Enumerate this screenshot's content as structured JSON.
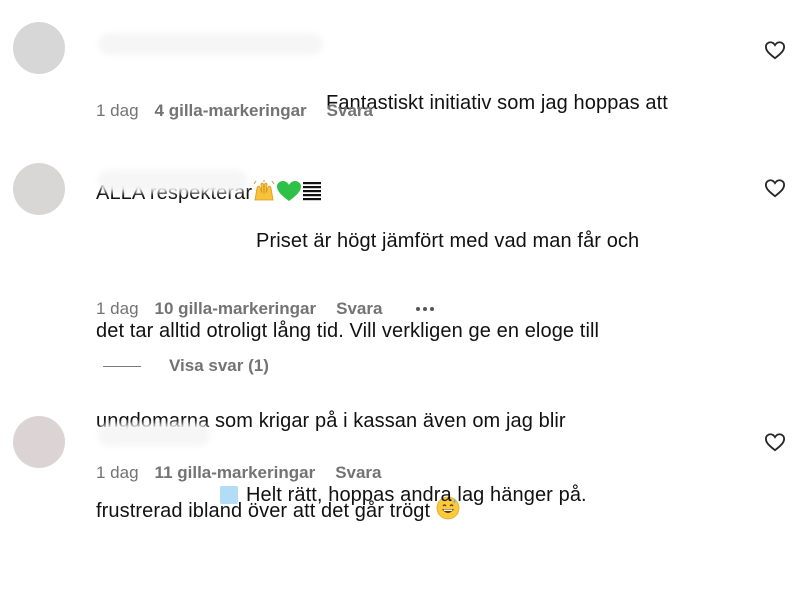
{
  "comments": [
    {
      "text_line1": "Fantastiskt initiativ som jag hoppas att",
      "text_line2": "ALLA respekterar",
      "emojis": [
        "raising-hands",
        "green-heart",
        "barcode"
      ],
      "time": "1 dag",
      "likes": "4 gilla-markeringar",
      "reply": "Svara",
      "avatar_color": "#d7d7d7"
    },
    {
      "text_line1": "Priset är högt jämfört med vad man får och",
      "text_line2": "det tar alltid otroligt lång tid. Vill verkligen ge en eloge till",
      "text_line3": "ungdomarna som krigar på i kassan även om jag blir",
      "text_line4": "frustrerad ibland över att det går trögt",
      "emojis": [
        "grinning-sweat-face"
      ],
      "time": "1 dag",
      "likes": "10 gilla-markeringar",
      "reply": "Svara",
      "avatar_color": "#d9d6d6"
    },
    {
      "text_line1": "Helt rätt, hoppas andra lag hänger på.",
      "emojis": [
        "light-blue-square"
      ],
      "time": "1 dag",
      "likes": "11 gilla-markeringar",
      "reply": "Svara",
      "avatar_color": "#dcd4d4"
    }
  ],
  "view_replies": "Visa svar (1)",
  "icons": {
    "like": "heart-outline-icon",
    "more": "more-options-icon"
  },
  "colors": {
    "text": "#111111",
    "meta": "#737373",
    "background": "#ffffff"
  }
}
